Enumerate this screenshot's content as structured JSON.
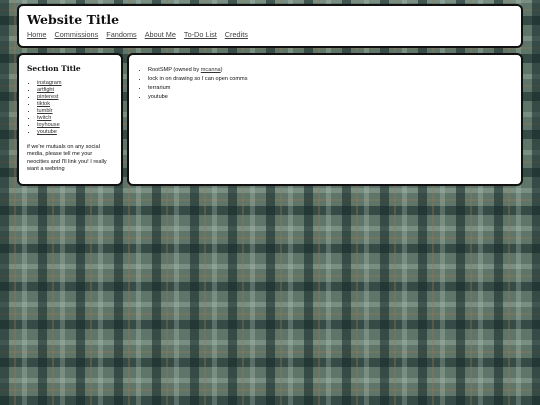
{
  "header": {
    "title": "Website Title",
    "nav": [
      "Home",
      "Commissions",
      "Fandoms",
      "About Me",
      "To-Do List",
      "Credits"
    ]
  },
  "sidebar": {
    "section_title": "Section Title",
    "links": [
      "instagram",
      "artfight",
      "pinterest",
      "tiktok",
      "tumblr",
      "twitch",
      "toyhouse",
      "youtube"
    ],
    "note": "if we're mutuals on any social media, please tell me your neocities and I'll link you! I really want a webring"
  },
  "main": {
    "item1_prefix": "RootSMP (owned by ",
    "item1_link": "mcanna",
    "item1_suffix": ")",
    "item2": "lock in on drawing so I can open comms",
    "item3": "terrarium",
    "item4": "youtube"
  }
}
